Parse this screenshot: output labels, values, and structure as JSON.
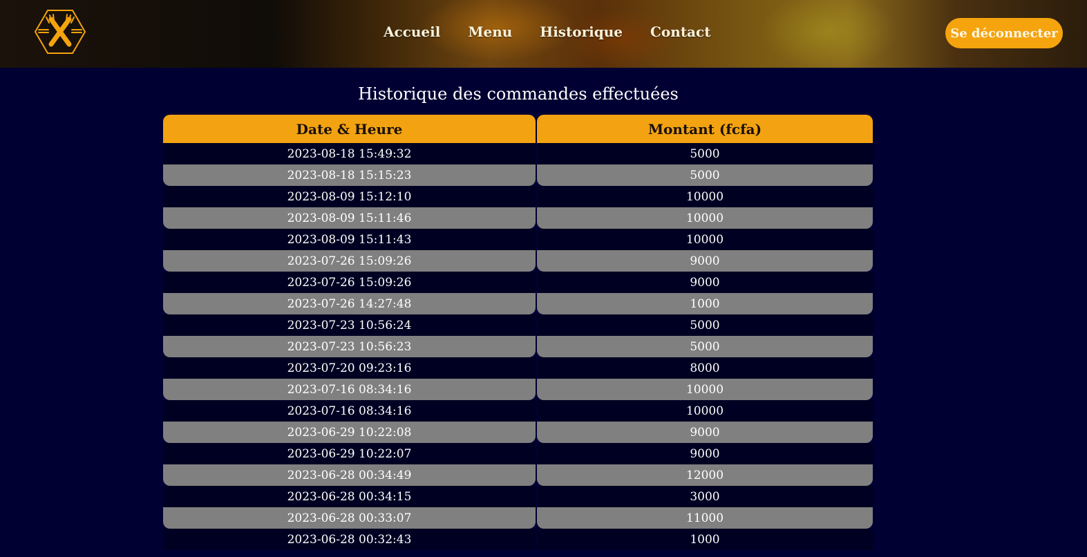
{
  "nav": {
    "items": [
      {
        "label": "Accueil"
      },
      {
        "label": "Menu"
      },
      {
        "label": "Historique"
      },
      {
        "label": "Contact"
      }
    ],
    "logout_label": "Se déconnecter"
  },
  "logo": {
    "icon": "crossed-fork-knife-hexagon-icon",
    "color": "#f5a40e"
  },
  "page": {
    "title": "Historique des commandes effectuées"
  },
  "table": {
    "headers": [
      "Date & Heure",
      "Montant (fcfa)"
    ],
    "rows": [
      {
        "date": "2023-08-18 15:49:32",
        "amount": "5000"
      },
      {
        "date": "2023-08-18 15:15:23",
        "amount": "5000"
      },
      {
        "date": "2023-08-09 15:12:10",
        "amount": "10000"
      },
      {
        "date": "2023-08-09 15:11:46",
        "amount": "10000"
      },
      {
        "date": "2023-08-09 15:11:43",
        "amount": "10000"
      },
      {
        "date": "2023-07-26 15:09:26",
        "amount": "9000"
      },
      {
        "date": "2023-07-26 15:09:26",
        "amount": "9000"
      },
      {
        "date": "2023-07-26 14:27:48",
        "amount": "1000"
      },
      {
        "date": "2023-07-23 10:56:24",
        "amount": "5000"
      },
      {
        "date": "2023-07-23 10:56:23",
        "amount": "5000"
      },
      {
        "date": "2023-07-20 09:23:16",
        "amount": "8000"
      },
      {
        "date": "2023-07-16 08:34:16",
        "amount": "10000"
      },
      {
        "date": "2023-07-16 08:34:16",
        "amount": "10000"
      },
      {
        "date": "2023-06-29 10:22:08",
        "amount": "9000"
      },
      {
        "date": "2023-06-29 10:22:07",
        "amount": "9000"
      },
      {
        "date": "2023-06-28 00:34:49",
        "amount": "12000"
      },
      {
        "date": "2023-06-28 00:34:15",
        "amount": "3000"
      },
      {
        "date": "2023-06-28 00:33:07",
        "amount": "11000"
      },
      {
        "date": "2023-06-28 00:32:43",
        "amount": "1000"
      }
    ]
  },
  "colors": {
    "accent": "#f5a40e",
    "background": "#000033",
    "row_dark": "#000022",
    "row_grey": "#808080"
  }
}
